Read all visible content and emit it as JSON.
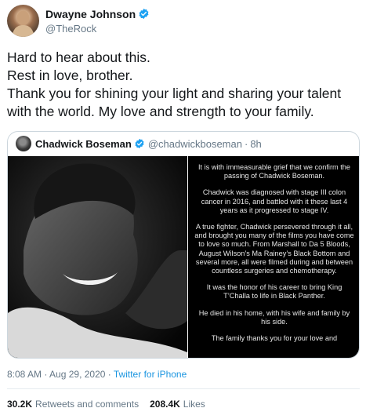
{
  "tweet": {
    "author_name": "Dwayne Johnson",
    "author_handle": "@TheRock",
    "body_lines": [
      "Hard to hear about this.",
      "Rest in love, brother.",
      "Thank you for shining your light and sharing your talent",
      "with the world. My love and strength to your family."
    ],
    "timestamp": "8:08 AM · Aug 29, 2020",
    "meta_separator": " · ",
    "source": "Twitter for iPhone",
    "retweets_count": "30.2K",
    "retweets_label": "Retweets and comments",
    "likes_count": "208.4K",
    "likes_label": "Likes"
  },
  "quoted": {
    "author_name": "Chadwick Boseman",
    "author_handle": "@chadwickboseman",
    "separator": "·",
    "time": "8h",
    "statement_paragraphs": [
      "It is with immeasurable grief that we confirm the passing of Chadwick Boseman.",
      "Chadwick was diagnosed with stage III colon cancer in 2016, and battled with it these last 4 years as it progressed to stage IV.",
      "A true fighter, Chadwick persevered through it all, and brought you many of the films you have come to love so much. From Marshall to Da 5 Bloods, August Wilson’s Ma Rainey’s Black Bottom and several more, all were filmed during and between countless surgeries and chemotherapy.",
      "It was the honor of his career to bring King T’Challa to life in Black Panther.",
      "He died in his home, with his wife and family by his side.",
      "The family thanks you for your love and"
    ]
  },
  "colors": {
    "verified": "#1da1f2",
    "link": "#1b95e0",
    "secondary_text": "#657786"
  },
  "icons": {
    "verified": "verified-badge-icon"
  }
}
